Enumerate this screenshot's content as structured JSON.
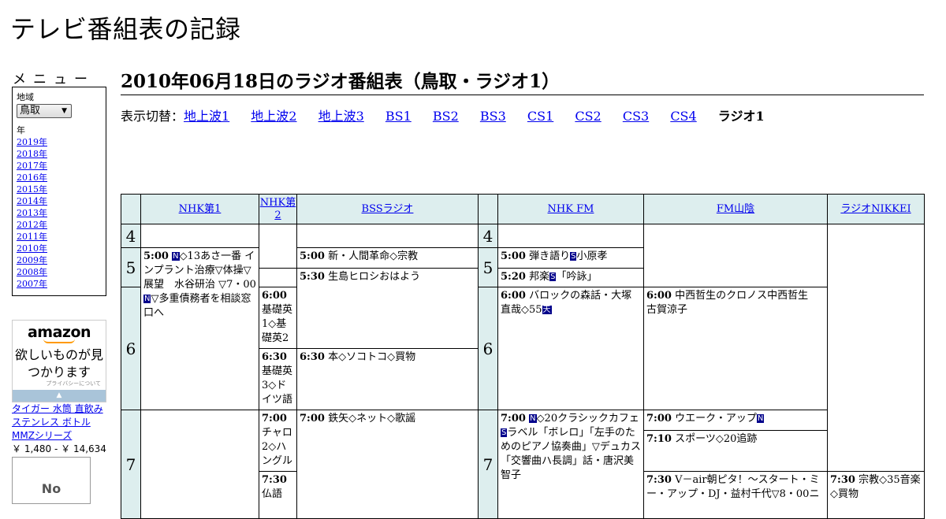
{
  "site": {
    "title": "テレビ番組表の記録"
  },
  "menu": {
    "heading": "メニュー",
    "region_label": "地域",
    "region_value": "鳥取",
    "year_label": "年",
    "years": [
      "2019年",
      "2018年",
      "2017年",
      "2016年",
      "2015年",
      "2014年",
      "2013年",
      "2012年",
      "2011年",
      "2010年",
      "2009年",
      "2008年",
      "2007年"
    ]
  },
  "ads": {
    "amazon_logo": "amazon",
    "amazon_tagline": "欲しいものが見つかります",
    "amazon_privacy": "プライバシーについて",
    "product_name": "タイガー 水筒 直飲み ステンレス ボトル MMZシリーズ",
    "product_price": "￥ 1,480 - ￥ 14,634",
    "no_image": "No"
  },
  "page": {
    "title": "2010年06月18日のラジオ番組表（鳥取・ラジオ1）"
  },
  "switcher": {
    "label": "表示切替：",
    "links": [
      "地上波1",
      "地上波2",
      "地上波3",
      "BS1",
      "BS2",
      "BS3",
      "CS1",
      "CS2",
      "CS3",
      "CS4"
    ],
    "current": "ラジオ1"
  },
  "grid": {
    "channels": [
      "NHK第1",
      "NHK第2",
      "BSSラジオ",
      "NHK FM",
      "FM山陰",
      "ラジオNIKKEI"
    ],
    "hours": [
      "4",
      "5",
      "6",
      "7"
    ],
    "programs": {
      "nhk1_500": {
        "time": "5:00",
        "text": "◇13あさ一番 インプラント治療▽体操▽展望　水谷研治 ▽7・00",
        "text2": "▽多重債務者を相談窓口へ"
      },
      "nhk2_600": {
        "time": "6:00",
        "text": "基礎英1◇基礎英2"
      },
      "nhk2_630": {
        "time": "6:30",
        "text": "基礎英3◇ドイツ語"
      },
      "nhk2_700": {
        "time": "7:00",
        "text": "チャロ2◇ハングル"
      },
      "nhk2_730": {
        "time": "7:30",
        "text": "仏語"
      },
      "bss_500": {
        "time": "5:00",
        "text": "新・人間革命◇宗教"
      },
      "bss_530": {
        "time": "5:30",
        "text": "生島ヒロシおはよう"
      },
      "bss_630": {
        "time": "6:30",
        "text": "本◇ソコトコ◇買物"
      },
      "bss_700": {
        "time": "7:00",
        "text": "鉄矢◇ネット◇歌謡"
      },
      "fm_500": {
        "time": "5:00",
        "text": "弾き語り",
        "text2": "小原孝"
      },
      "fm_520": {
        "time": "5:20",
        "text": "邦楽",
        "text2": "「吟詠」"
      },
      "fm_600": {
        "time": "6:00",
        "text": "バロックの森話・大塚直哉◇55"
      },
      "fm_700": {
        "time": "7:00",
        "text": "◇20クラシックカフェ",
        "text2": "ラベル「ボレロ」「左手のためのピアノ協奏曲」▽デュカス「交響曲ハ長調」話・唐沢美智子"
      },
      "sanin_600": {
        "time": "6:00",
        "text": "中西哲生のクロノス中西哲生　古賀涼子"
      },
      "sanin_700": {
        "time": "7:00",
        "text": "ウエーク・アップ"
      },
      "sanin_710": {
        "time": "7:10",
        "text": "スポーツ◇20追跡"
      },
      "sanin_730": {
        "time": "7:30",
        "text": "V－air朝ピタ！～スタート・ミー・アップ・DJ・益村千代▽8・00ニ"
      },
      "nikkei_730": {
        "time": "7:30",
        "text": "宗教◇35音楽◇買物"
      }
    },
    "badges": {
      "news": "N",
      "stereo": "S",
      "weather": "天"
    }
  },
  "colors": {
    "header_bg": "#ddeeee",
    "link": "#0000ee",
    "badge_bg": "#00008b"
  }
}
